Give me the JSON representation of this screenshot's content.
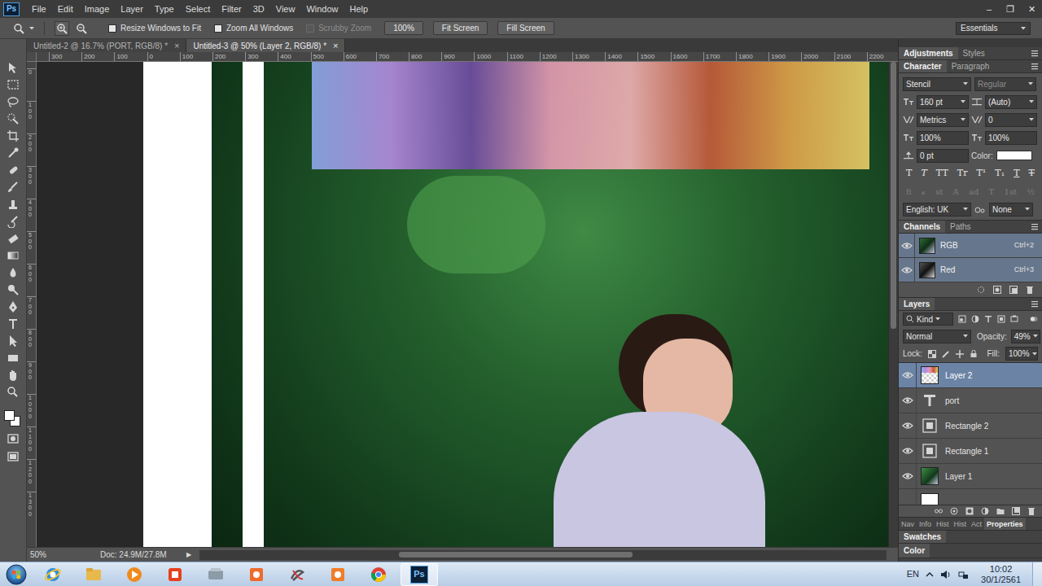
{
  "app": {
    "logo": "Ps"
  },
  "menu": [
    "File",
    "Edit",
    "Image",
    "Layer",
    "Type",
    "Select",
    "Filter",
    "3D",
    "View",
    "Window",
    "Help"
  ],
  "window_controls": [
    "–",
    "❐",
    "✕"
  ],
  "options_bar": {
    "checkboxes": [
      {
        "label": "Resize Windows to Fit",
        "checked": false,
        "disabled": false
      },
      {
        "label": "Zoom All Windows",
        "checked": false,
        "disabled": false
      },
      {
        "label": "Scrubby Zoom",
        "checked": false,
        "disabled": true
      }
    ],
    "buttons": [
      "100%",
      "Fit Screen",
      "Fill Screen"
    ],
    "workspace": "Essentials"
  },
  "doc_tabs": [
    {
      "label": "Untitled-2 @ 16.7% (PORT, RGB/8) *",
      "close": "×",
      "selected": false
    },
    {
      "label": "Untitled-3 @ 50% (Layer 2, RGB/8) *",
      "close": "×",
      "selected": true
    }
  ],
  "rulers": {
    "top": [
      "300",
      "200",
      "100",
      "0",
      "100",
      "200",
      "300",
      "400",
      "500",
      "600",
      "700",
      "800",
      "900",
      "1000",
      "1100",
      "1200",
      "1300",
      "1400",
      "1500",
      "1600",
      "1700",
      "1800",
      "1900",
      "2000",
      "2100",
      "2200"
    ],
    "left": [
      "0",
      "100",
      "200",
      "300",
      "400",
      "500",
      "600",
      "700",
      "800",
      "900",
      "1000",
      "1100",
      "1200",
      "1300"
    ]
  },
  "scrollbars": {
    "vertical": {
      "start": 0.0,
      "size": 0.55
    },
    "horizontal": {
      "start": 0.29,
      "size": 0.34
    }
  },
  "panels": {
    "top_tabs": [
      {
        "label": "Adjustments",
        "selected": true
      },
      {
        "label": "Styles",
        "selected": false
      }
    ],
    "character": {
      "tabs": [
        {
          "label": "Character",
          "selected": true
        },
        {
          "label": "Paragraph",
          "selected": false
        }
      ],
      "font_family": "Stencil",
      "font_style": "Regular",
      "font_style_disabled": true,
      "size": "160 pt",
      "leading": "(Auto)",
      "kerning": "Metrics",
      "tracking": "0",
      "vertical_scale": "100%",
      "horizontal_scale": "100%",
      "baseline": "0 pt",
      "color_label": "Color:",
      "color": "#ffffff",
      "style_buttons": [
        "T",
        "T",
        "TT",
        "Tr",
        "T¹",
        "T₁",
        "T",
        "T"
      ],
      "opentype_buttons": [
        "ﬁ",
        "ℴ",
        "st",
        "A",
        "ad",
        "T",
        "1st",
        "½"
      ],
      "opentype_disabled": true,
      "language": "English: UK",
      "antialias": "None"
    },
    "channels": {
      "tabs": [
        {
          "label": "Channels",
          "selected": true
        },
        {
          "label": "Paths",
          "selected": false
        }
      ],
      "rows": [
        {
          "name": "RGB",
          "shortcut": "Ctrl+2",
          "kind": "composite",
          "visible": true,
          "selected": true
        },
        {
          "name": "Red",
          "shortcut": "Ctrl+3",
          "kind": "channel",
          "visible": true,
          "selected": true
        }
      ]
    },
    "layers": {
      "title": "Layers",
      "filter": "Kind",
      "blend_mode": "Normal",
      "opacity_label": "Opacity:",
      "opacity": "49%",
      "lock_label": "Lock:",
      "fill_label": "Fill:",
      "fill": "100%",
      "rows": [
        {
          "name": "Layer 2",
          "kind": "pixel",
          "visible": true,
          "selected": true
        },
        {
          "name": "port",
          "kind": "text",
          "visible": true,
          "selected": false
        },
        {
          "name": "Rectangle 2",
          "kind": "shape",
          "visible": true,
          "selected": false
        },
        {
          "name": "Rectangle 1",
          "kind": "shape",
          "visible": true,
          "selected": false
        },
        {
          "name": "Layer 1",
          "kind": "photo",
          "visible": true,
          "selected": false
        }
      ]
    },
    "bottom_tabs": [
      {
        "label": "Nav",
        "selected": false
      },
      {
        "label": "Info",
        "selected": false
      },
      {
        "label": "Hist",
        "selected": false
      },
      {
        "label": "Hist",
        "selected": false
      },
      {
        "label": "Act",
        "selected": false
      },
      {
        "label": "Properties",
        "selected": true
      }
    ],
    "swatches_title": "Swatches",
    "color_title": "Color"
  },
  "status_bar": {
    "zoom": "50%",
    "doc": "Doc: 24.9M/27.8M",
    "menu_arrow": "▶"
  },
  "taskbar": {
    "apps": [
      {
        "selected": false
      },
      {
        "selected": false
      },
      {
        "selected": false
      },
      {
        "selected": false
      },
      {
        "selected": false
      },
      {
        "selected": false
      },
      {
        "selected": false
      },
      {
        "selected": false
      },
      {
        "selected": false
      },
      {
        "selected": true,
        "label": "Ps"
      }
    ],
    "language": "EN",
    "time": "10:02",
    "date": "30/1/2561"
  }
}
